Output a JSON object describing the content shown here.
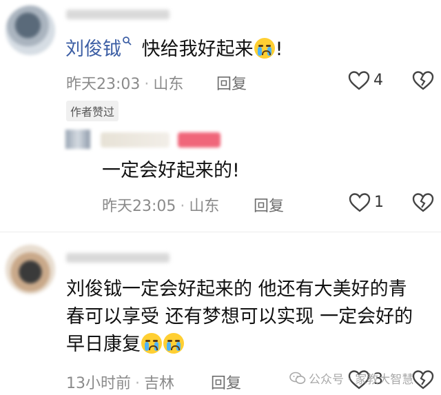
{
  "comment1": {
    "author_name": "刘俊钺",
    "text": "快给我好起来",
    "text_suffix": "!",
    "time": "昨天23:03",
    "location": "山东",
    "reply_label": "回复",
    "like_count": "4",
    "author_badge": "作者赞过"
  },
  "reply1": {
    "text": "一定会好起来的!",
    "time": "昨天23:05",
    "location": "山东",
    "reply_label": "回复",
    "like_count": "1"
  },
  "comment2": {
    "line1": "刘俊钺一定会好起来的 他还有大美好的青",
    "line2": "春可以享受 还有梦想可以实现 一定会好的",
    "line3": "早日康复",
    "time": "13小时前",
    "location": "吉林",
    "reply_label": "回复",
    "like_count": "3"
  },
  "watermark": {
    "text": "公众号 · 家教大智慧"
  },
  "colors": {
    "author_blue": "#3d5fa5",
    "meta_gray": "#8a8a8a",
    "emoji_yellow": "#ffcf33"
  },
  "icons": {
    "like": "heart-outline-icon",
    "dislike": "broken-heart-icon",
    "search": "search-icon",
    "crying_emoji": "crying-face-emoji",
    "wechat": "wechat-icon"
  }
}
